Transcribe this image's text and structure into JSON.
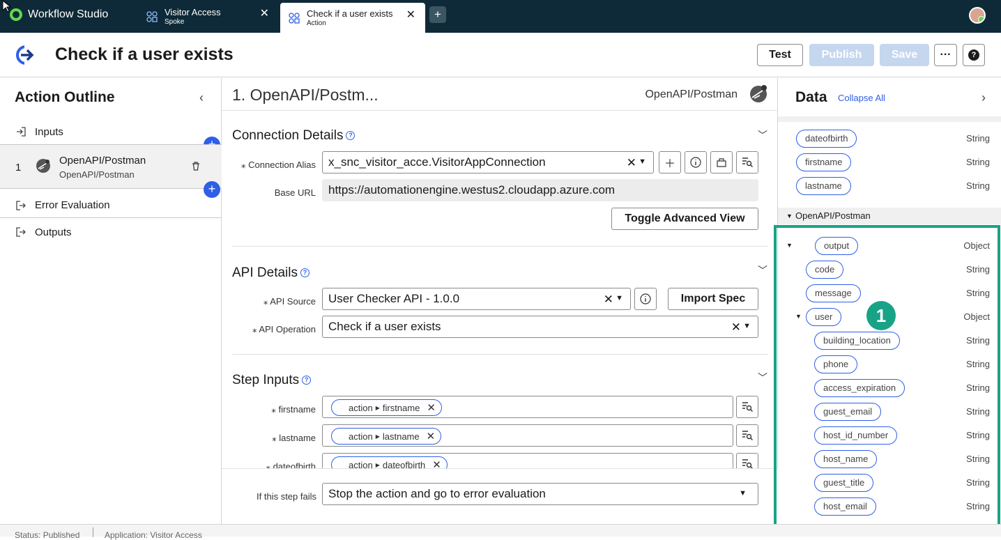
{
  "topbar": {
    "app_name": "Workflow Studio",
    "tabs": [
      {
        "title": "Visitor Access",
        "subtitle": "Spoke"
      },
      {
        "title": "Check if a user exists",
        "subtitle": "Action"
      }
    ],
    "new_tab": "+"
  },
  "header": {
    "title": "Check if a user exists",
    "test": "Test",
    "publish": "Publish",
    "save": "Save",
    "more": "···",
    "help": "?"
  },
  "outline": {
    "title": "Action Outline",
    "inputs": "Inputs",
    "step_number": "1",
    "step_title": "OpenAPI/Postman",
    "step_subtitle": "OpenAPI/Postman",
    "error_evaluation": "Error Evaluation",
    "outputs": "Outputs"
  },
  "step": {
    "title": "1.  OpenAPI/Postm...",
    "type_label": "OpenAPI/Postman",
    "connection": {
      "section": "Connection Details",
      "alias_label": "Connection Alias",
      "alias_value": "x_snc_visitor_acce.VisitorAppConnection",
      "base_url_label": "Base URL",
      "base_url_value": "https://automationengine.westus2.cloudapp.azure.com",
      "toggle_advanced": "Toggle Advanced View"
    },
    "api": {
      "section": "API Details",
      "source_label": "API Source",
      "source_value": "User Checker API - 1.0.0",
      "import_spec": "Import Spec",
      "operation_label": "API Operation",
      "operation_value": "Check if a user exists"
    },
    "inputs": {
      "section": "Step Inputs",
      "rows": [
        {
          "label": "firstname",
          "pill_source": "action",
          "pill_field": "firstname"
        },
        {
          "label": "lastname",
          "pill_source": "action",
          "pill_field": "lastname"
        },
        {
          "label": "dateofbirth",
          "pill_source": "action",
          "pill_field": "dateofbirth"
        }
      ]
    },
    "fail": {
      "label": "If this step fails",
      "value": "Stop the action and go to error evaluation"
    }
  },
  "data_panel": {
    "title": "Data",
    "collapse_all": "Collapse All",
    "action_inputs": [
      {
        "name": "dateofbirth",
        "type": "String"
      },
      {
        "name": "firstname",
        "type": "String"
      },
      {
        "name": "lastname",
        "type": "String"
      }
    ],
    "section": "OpenAPI/Postman",
    "output": {
      "name": "output",
      "type": "Object"
    },
    "output_children": [
      {
        "name": "code",
        "type": "String"
      },
      {
        "name": "message",
        "type": "String"
      }
    ],
    "user": {
      "name": "user",
      "type": "Object"
    },
    "user_children": [
      {
        "name": "building_location",
        "type": "String"
      },
      {
        "name": "phone",
        "type": "String"
      },
      {
        "name": "access_expiration",
        "type": "String"
      },
      {
        "name": "guest_email",
        "type": "String"
      },
      {
        "name": "host_id_number",
        "type": "String"
      },
      {
        "name": "host_name",
        "type": "String"
      },
      {
        "name": "guest_title",
        "type": "String"
      },
      {
        "name": "host_email",
        "type": "String"
      }
    ],
    "callout": "1"
  },
  "status": {
    "status": "Status: Published",
    "application": "Application: Visitor Access"
  },
  "colors": {
    "accent": "#2e5fe6",
    "highlight": "#18a387",
    "topbar": "#0e2a38"
  }
}
